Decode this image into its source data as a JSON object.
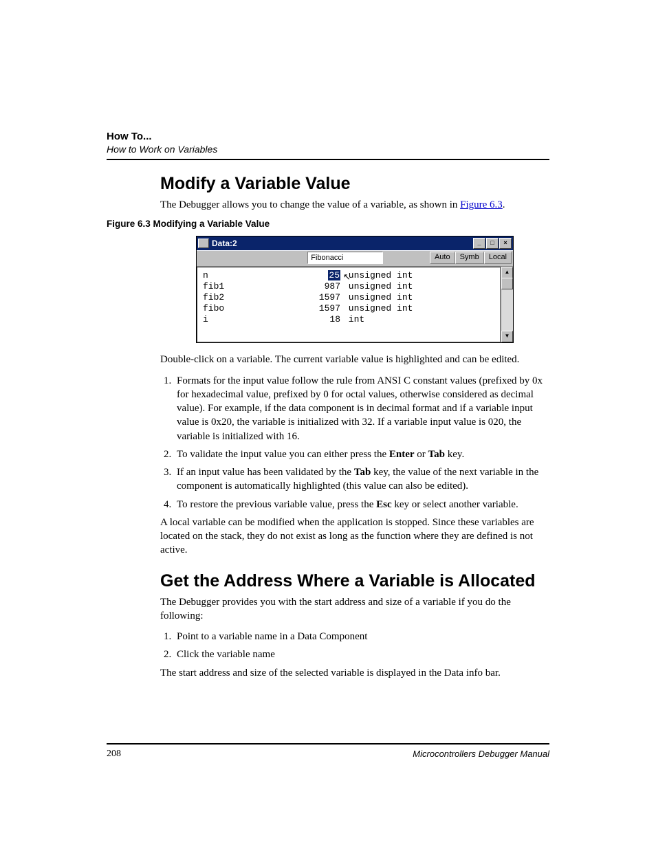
{
  "header": {
    "title": "How To...",
    "subtitle": "How to Work on Variables"
  },
  "section1": {
    "heading": "Modify a Variable Value",
    "intro_pre": "The Debugger allows you to change the value of a variable, as shown in ",
    "intro_link": "Figure 6.3",
    "intro_post": ".",
    "figcaption": "Figure 6.3  Modifying a Variable Value",
    "after_fig": "Double-click on a variable. The current variable value is highlighted and can be edited.",
    "list": [
      "Formats for the input value follow the rule from ANSI C constant values (prefixed by 0x for hexadecimal value, prefixed by 0 for octal values, otherwise considered as decimal value). For example, if the data component is in decimal format and if a variable input value is 0x20, the variable is initialized with 32. If a variable input value is 020, the variable is initialized with 16.",
      "To validate the input value you can either press the <b>Enter</b> or <b>Tab</b> key.",
      "If an input value has been validated by the <b>Tab</b> key, the value of the next variable in the component is automatically highlighted (this value can also be edited).",
      "To restore the previous variable value, press the <b>Esc</b> key or select another variable."
    ],
    "after_list": "A local variable can be modified when the application is stopped. Since these variables are located on the stack, they do not exist as long as the function where they are defined is not active."
  },
  "figure": {
    "title": "Data:2",
    "toolfield": "Fibonacci",
    "buttons": {
      "auto": "Auto",
      "symb": "Symb",
      "local": "Local"
    },
    "rows": [
      {
        "name": "n",
        "value": "25",
        "type": "unsigned int",
        "highlighted": true
      },
      {
        "name": "fib1",
        "value": "987",
        "type": "unsigned int",
        "highlighted": false
      },
      {
        "name": "fib2",
        "value": "1597",
        "type": "unsigned int",
        "highlighted": false
      },
      {
        "name": "fibo",
        "value": "1597",
        "type": "unsigned int",
        "highlighted": false
      },
      {
        "name": "i",
        "value": "18",
        "type": "int",
        "highlighted": false
      }
    ]
  },
  "section2": {
    "heading": "Get the Address Where a Variable is Allocated",
    "intro": "The Debugger provides you with the start address and size of a variable if you do the following:",
    "list": [
      "Point to a variable name in a Data Component",
      "Click the variable name"
    ],
    "after": "The start address and size of the selected variable is displayed in the Data info bar."
  },
  "footer": {
    "page": "208",
    "manual": "Microcontrollers Debugger Manual"
  }
}
